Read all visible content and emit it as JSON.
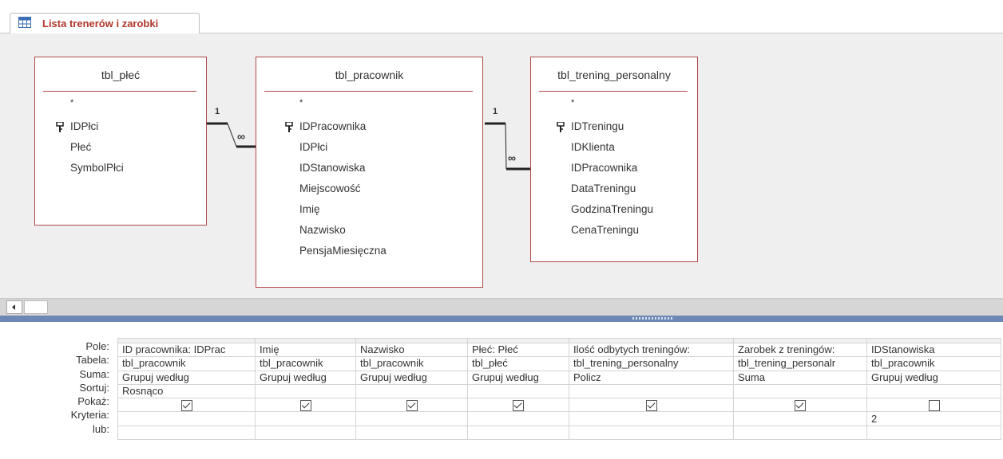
{
  "tab": {
    "title": "Lista trenerów i zarobki",
    "icon": "query-icon"
  },
  "tables": [
    {
      "name": "tbl_płeć",
      "star": "*",
      "fields": [
        {
          "name": "IDPłci",
          "key": true
        },
        {
          "name": "Płeć",
          "key": false
        },
        {
          "name": "SymbolPłci",
          "key": false
        }
      ]
    },
    {
      "name": "tbl_pracownik",
      "star": "*",
      "fields": [
        {
          "name": "IDPracownika",
          "key": true
        },
        {
          "name": "IDPłci",
          "key": false
        },
        {
          "name": "IDStanowiska",
          "key": false
        },
        {
          "name": "Miejscowość",
          "key": false
        },
        {
          "name": "Imię",
          "key": false
        },
        {
          "name": "Nazwisko",
          "key": false
        },
        {
          "name": "PensjaMiesięczna",
          "key": false
        }
      ]
    },
    {
      "name": "tbl_trening_personalny",
      "star": "*",
      "fields": [
        {
          "name": "IDTreningu",
          "key": true
        },
        {
          "name": "IDKlienta",
          "key": false
        },
        {
          "name": "IDPracownika",
          "key": false
        },
        {
          "name": "DataTreningu",
          "key": false
        },
        {
          "name": "GodzinaTreningu",
          "key": false
        },
        {
          "name": "CenaTreningu",
          "key": false
        }
      ]
    }
  ],
  "joins": [
    {
      "one": "1",
      "many": "∞"
    },
    {
      "one": "1",
      "many": "∞"
    }
  ],
  "grid": {
    "row_labels": [
      "Pole:",
      "Tabela:",
      "Suma:",
      "Sortuj:",
      "Pokaż:",
      "Kryteria:",
      "lub:"
    ],
    "columns": [
      {
        "pole": "ID pracownika: IDPrac",
        "tabela": "tbl_pracownik",
        "suma": "Grupuj według",
        "sortuj": "Rosnąco",
        "pokaz": true,
        "kryteria": "",
        "lub": ""
      },
      {
        "pole": "Imię",
        "tabela": "tbl_pracownik",
        "suma": "Grupuj według",
        "sortuj": "",
        "pokaz": true,
        "kryteria": "",
        "lub": ""
      },
      {
        "pole": "Nazwisko",
        "tabela": "tbl_pracownik",
        "suma": "Grupuj według",
        "sortuj": "",
        "pokaz": true,
        "kryteria": "",
        "lub": ""
      },
      {
        "pole": "Płeć: Płeć",
        "tabela": "tbl_płeć",
        "suma": "Grupuj według",
        "sortuj": "",
        "pokaz": true,
        "kryteria": "",
        "lub": ""
      },
      {
        "pole": "Ilość odbytych treningów:",
        "tabela": "tbl_trening_personalny",
        "suma": "Policz",
        "sortuj": "",
        "pokaz": true,
        "kryteria": "",
        "lub": ""
      },
      {
        "pole": "Zarobek z treningów:",
        "tabela": "tbl_trening_personalr",
        "suma": "Suma",
        "sortuj": "",
        "pokaz": true,
        "kryteria": "",
        "lub": ""
      },
      {
        "pole": "IDStanowiska",
        "tabela": "tbl_pracownik",
        "suma": "Grupuj według",
        "sortuj": "",
        "pokaz": false,
        "kryteria": "2",
        "lub": ""
      }
    ]
  },
  "colors": {
    "accent": "#b0352a",
    "table_border": "#b24848",
    "design_bg": "#efefef",
    "splitter": "#6e88b6"
  }
}
